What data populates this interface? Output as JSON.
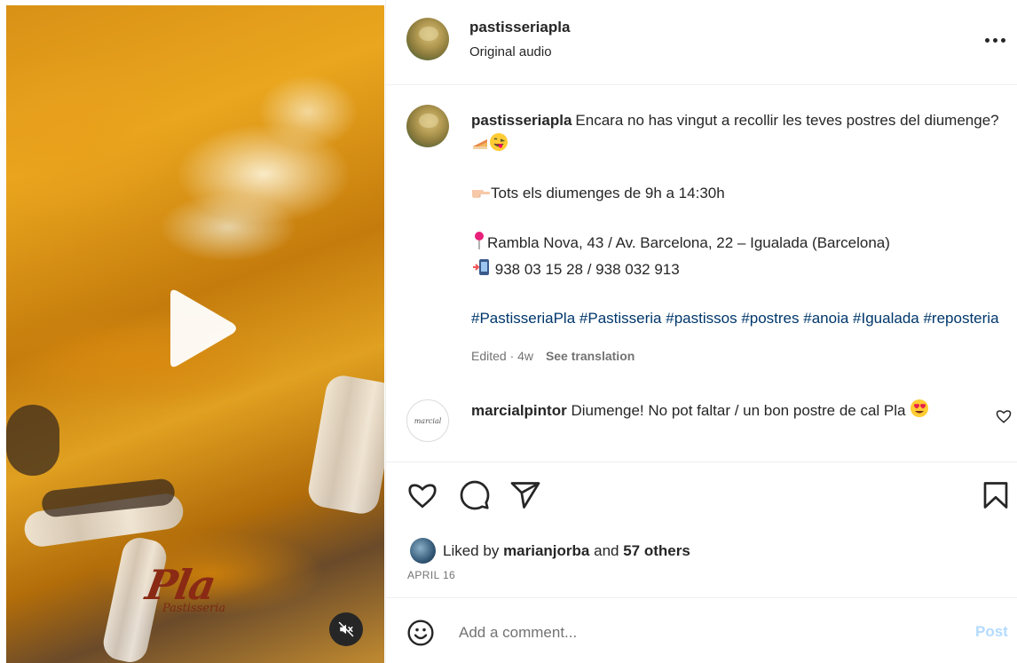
{
  "header": {
    "username": "pastisseriapla",
    "audio_label": "Original audio",
    "more_icon": "more-horizontal-icon"
  },
  "media": {
    "brand_logo_text": "Pla",
    "brand_logo_sub": "Pastisseria",
    "play_icon": "play-icon",
    "mute_icon": "muted-speaker-icon"
  },
  "caption": {
    "username": "pastisseriapla",
    "line1": "Encara no has vingut a recollir les teves postres del diumenge?",
    "line1_emojis": [
      "cake-slice-emoji",
      "yum-face-emoji"
    ],
    "hours": "Tots els diumenges de 9h a 14:30h",
    "hours_emoji": "pointing-hand-emoji",
    "address": "Rambla Nova, 43 / Av. Barcelona, 22 – Igualada (Barcelona)",
    "address_emoji": "pin-emoji",
    "phones": "938 03 15 28 / 938 032 913",
    "phones_emoji": "mobile-phone-emoji",
    "hashtags": [
      "#PastisseriaPla",
      "#Pastisseria",
      "#pastissos",
      "#postres",
      "#anoia",
      "#Igualada",
      "#reposteria"
    ],
    "edited": "Edited · 4w",
    "see_translation": "See translation"
  },
  "comment": {
    "username": "marcialpintor",
    "text": "Diumenge! No pot faltar / un bon postre de cal Pla",
    "emoji": "heart-eyes-emoji",
    "avatar_text": "marcial"
  },
  "actions": {
    "like_icon": "heart-icon",
    "comment_icon": "comment-bubble-icon",
    "share_icon": "send-paper-plane-icon",
    "save_icon": "bookmark-icon",
    "liked_prefix": "Liked by",
    "liked_user": "marianjorba",
    "liked_and": "and",
    "liked_others": "57 others",
    "date": "APRIL 16"
  },
  "add_comment": {
    "placeholder": "Add a comment...",
    "post_label": "Post",
    "emoji_icon": "smiley-icon"
  },
  "colors": {
    "text": "#262626",
    "secondary": "#737373",
    "link": "#00376b",
    "post_disabled": "#b3dbff",
    "divider": "#efefef"
  }
}
